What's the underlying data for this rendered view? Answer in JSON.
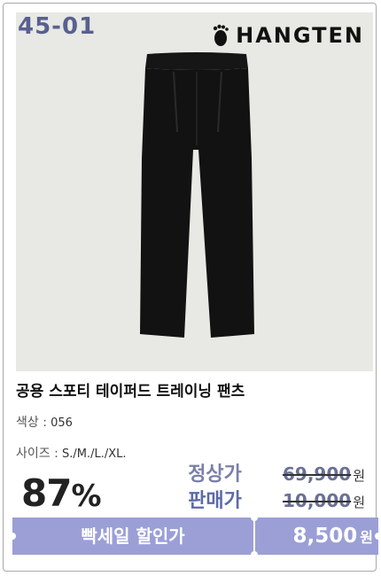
{
  "image": {
    "code": "45-01",
    "brand": "HANGTEN",
    "brand_icon": "footprint-icon"
  },
  "product": {
    "title": "공용 스포티 테이퍼드 트레이닝 팬츠",
    "color_label": "색상 :",
    "color_value": "056",
    "size_label": "사이즈 :",
    "size_value": "S./M./L./XL."
  },
  "pricing": {
    "discount_value": "87",
    "discount_unit": "%",
    "list_label": "정상가",
    "list_price": "69,900",
    "list_unit": "원",
    "sale_label": "판매가",
    "sale_price": "10,000",
    "sale_unit": "원"
  },
  "promo_bar": {
    "label": "빡세일 할인가",
    "final_price": "8,500",
    "final_unit": "원"
  },
  "colors": {
    "accent": "#9b9fd6",
    "code_text": "#58608f",
    "price_text": "#6b7096",
    "photo_bg": "#e8e8e4"
  }
}
